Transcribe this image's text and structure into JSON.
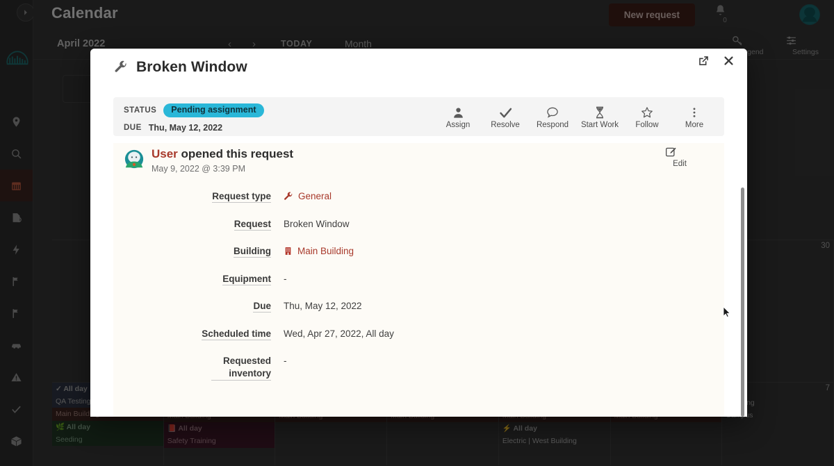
{
  "background": {
    "page_title": "Calendar",
    "new_request_label": "New request",
    "notification_count": "0",
    "toolbar": {
      "month_label": "April 2022",
      "prev_label": "‹",
      "next_label": "›",
      "today_label": "TODAY",
      "view_label": "Month",
      "tools": [
        {
          "name": "legend",
          "label": "Legend"
        },
        {
          "name": "settings",
          "label": "Settings"
        }
      ]
    },
    "day_numbers": {
      "row1": "30",
      "row2": "7"
    },
    "calendar_events": [
      {
        "column": 1,
        "items": [
          {
            "allday": "All day",
            "title": "QA Testing",
            "style": "ev-blue",
            "icon": "check-icon"
          },
          {
            "title": "Main Building",
            "style": "ev-head"
          },
          {
            "allday": "All day",
            "title": "Seeding",
            "style": "ev-green",
            "icon": "leaf-icon"
          }
        ]
      },
      {
        "column": 2,
        "items": [
          {
            "title": "Main Building",
            "style": "ev-head"
          },
          {
            "allday": "All day",
            "title": "Safety Training",
            "style": "ev-maroon",
            "icon": "book-icon"
          }
        ]
      },
      {
        "column": 3,
        "items": [
          {
            "title": "Main Building",
            "style": "ev-head"
          }
        ]
      },
      {
        "column": 4,
        "items": [
          {
            "title": "Main Building",
            "style": "ev-head"
          }
        ]
      },
      {
        "column": 5,
        "items": [
          {
            "title": "Main Building",
            "style": "ev-head"
          },
          {
            "allday": "All day",
            "title": "Electric | West Building",
            "style": "ev-plain",
            "icon": "bolt-icon"
          }
        ]
      },
      {
        "column": 6,
        "items": [
          {
            "title": "Main Building",
            "style": "ev-head"
          }
        ]
      },
      {
        "column": 7,
        "items": [
          {
            "title": "Spraying",
            "style": "ev-plain"
          },
          {
            "title": "Campus",
            "style": "ev-plain"
          }
        ]
      }
    ],
    "rail_items": [
      {
        "name": "location",
        "icon": "map-pin-icon"
      },
      {
        "name": "search",
        "icon": "search-icon"
      },
      {
        "name": "calendar",
        "icon": "calendar-icon",
        "active": true
      },
      {
        "name": "requests",
        "icon": "file-badge-icon"
      },
      {
        "name": "utilities",
        "icon": "bolt-icon"
      },
      {
        "name": "projects",
        "icon": "flag-icon"
      },
      {
        "name": "inspections",
        "icon": "flag-2-icon"
      },
      {
        "name": "vehicles",
        "icon": "car-icon"
      },
      {
        "name": "alerts",
        "icon": "warning-icon"
      },
      {
        "name": "tasks",
        "icon": "check-icon"
      },
      {
        "name": "inventory",
        "icon": "box-icon"
      }
    ]
  },
  "modal": {
    "title": "Broken Window",
    "title_icon": "wrench-icon",
    "open_in_new_label": "Open in new window",
    "close_label": "Close",
    "status": {
      "status_key": "STATUS",
      "status_value": "Pending assignment",
      "due_key": "DUE",
      "due_value": "Thu, May 12, 2022",
      "badge_color": "#2ab7d8"
    },
    "actions": [
      {
        "name": "assign",
        "label": "Assign",
        "icon": "person-icon"
      },
      {
        "name": "resolve",
        "label": "Resolve",
        "icon": "check-icon"
      },
      {
        "name": "respond",
        "label": "Respond",
        "icon": "speech-bubble-icon"
      },
      {
        "name": "start-work",
        "label": "Start Work",
        "icon": "hourglass-icon"
      },
      {
        "name": "follow",
        "label": "Follow",
        "icon": "star-icon"
      },
      {
        "name": "more",
        "label": "More",
        "icon": "kebab-menu-icon"
      }
    ],
    "feed": {
      "avatar": "👤",
      "actor": "User",
      "action_text": " opened this request",
      "timestamp": "May 9, 2022 @ 3:39 PM",
      "edit_label": "Edit",
      "edit_icon": "pencil-square-icon"
    },
    "details": [
      {
        "label": "Request type",
        "value": "General",
        "link": true,
        "icon": "wrench-icon"
      },
      {
        "label": "Request",
        "value": "Broken Window",
        "link": false,
        "icon": ""
      },
      {
        "label": "Building",
        "value": "Main Building",
        "link": true,
        "icon": "building-icon"
      },
      {
        "label": "Equipment",
        "value": "-",
        "link": false,
        "icon": ""
      },
      {
        "label": "Due",
        "value": "Thu, May 12, 2022",
        "link": false,
        "icon": ""
      },
      {
        "label": "Scheduled time",
        "value": "Wed, Apr 27, 2022, All day",
        "link": false,
        "icon": ""
      },
      {
        "label": "Requested inventory",
        "value": "-",
        "link": false,
        "icon": ""
      }
    ]
  }
}
